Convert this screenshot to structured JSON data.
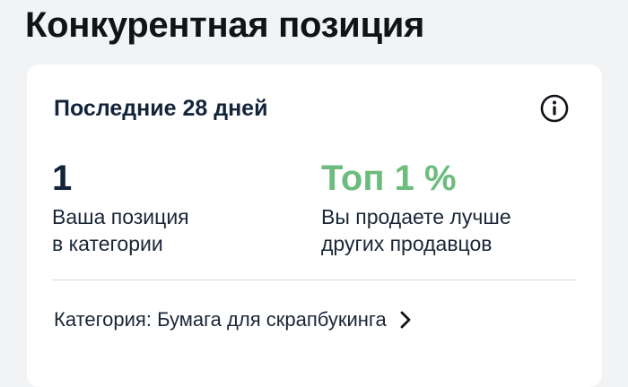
{
  "page": {
    "title": "Конкурентная позиция"
  },
  "card": {
    "period_label": "Последние 28 дней",
    "info_icon": "info-circle-icon",
    "position": {
      "value": "1",
      "description_line1": "Ваша позиция",
      "description_line2": "в категории"
    },
    "rank": {
      "value": "Топ 1 %",
      "description_line1": "Вы продаете лучше",
      "description_line2": "других продавцов",
      "color": "#6cbc7d"
    },
    "category": {
      "label": "Категория: Бумага для скрапбукинга",
      "icon": "chevron-right-icon"
    }
  }
}
